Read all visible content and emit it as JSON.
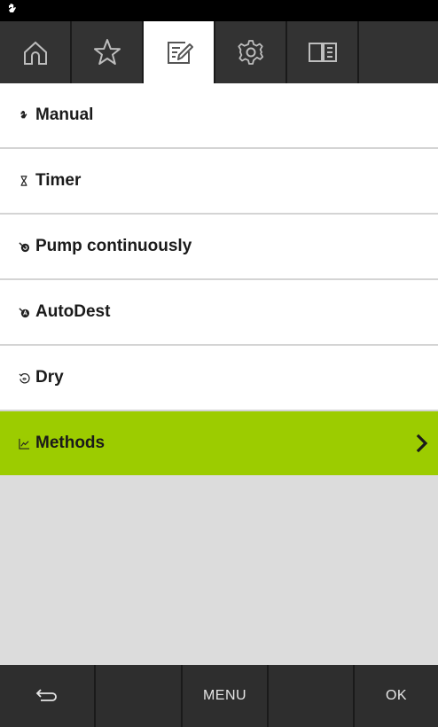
{
  "status_bar": {
    "mode_icon": "hand-icon"
  },
  "tabs": [
    {
      "name": "home",
      "icon": "home-icon",
      "active": false
    },
    {
      "name": "favorites",
      "icon": "star-icon",
      "active": false
    },
    {
      "name": "edit",
      "icon": "edit-icon",
      "active": true
    },
    {
      "name": "settings",
      "icon": "gear-icon",
      "active": false
    },
    {
      "name": "manual",
      "icon": "book-icon",
      "active": false
    }
  ],
  "menu": {
    "items": [
      {
        "label": "Manual",
        "icon": "hand-icon"
      },
      {
        "label": "Timer",
        "icon": "hourglass-icon"
      },
      {
        "label": "Pump continuously",
        "icon": "pump-icon"
      },
      {
        "label": "AutoDest",
        "icon": "autodest-icon"
      },
      {
        "label": "Dry",
        "icon": "dry-icon"
      },
      {
        "label": "Methods",
        "icon": "chart-icon",
        "selected": true
      }
    ],
    "selected_color": "#9ccc00"
  },
  "bottom_bar": {
    "back_icon": "back-arrow-icon",
    "menu_label": "MENU",
    "ok_label": "OK"
  }
}
